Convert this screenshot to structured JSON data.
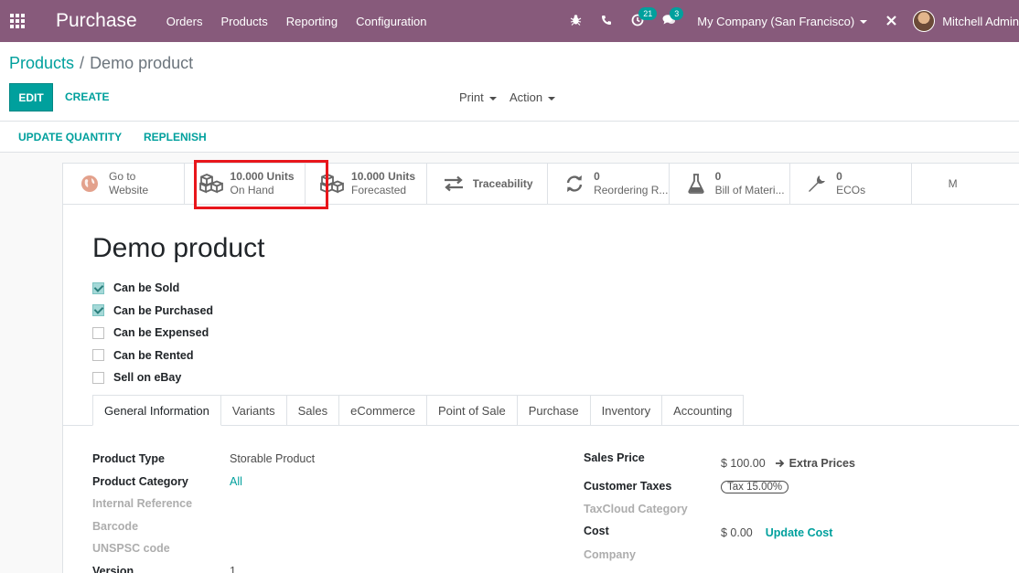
{
  "navbar": {
    "app_title": "Purchase",
    "menu": [
      "Orders",
      "Products",
      "Reporting",
      "Configuration"
    ],
    "activity_count": "21",
    "messages_count": "3",
    "company": "My Company (San Francisco)",
    "user": "Mitchell Admin"
  },
  "breadcrumb": {
    "parent": "Products",
    "separator": "/",
    "current": "Demo product"
  },
  "control": {
    "edit": "EDIT",
    "create": "CREATE",
    "print": "Print",
    "action": "Action"
  },
  "statusbar": {
    "update_quantity": "UPDATE QUANTITY",
    "replenish": "REPLENISH"
  },
  "smart_buttons": [
    {
      "value": "Go to",
      "label": "Website",
      "icon": "globe-icon"
    },
    {
      "value": "10.000 Units",
      "label": "On Hand",
      "icon": "cubes-icon"
    },
    {
      "value": "10.000 Units",
      "label": "Forecasted",
      "icon": "cubes-icon"
    },
    {
      "value": "",
      "label": "Traceability",
      "icon": "exchange-icon"
    },
    {
      "value": "0",
      "label": "Reordering R...",
      "icon": "refresh-icon"
    },
    {
      "value": "0",
      "label": "Bill of Materi...",
      "icon": "flask-icon"
    },
    {
      "value": "0",
      "label": "ECOs",
      "icon": "wrench-icon"
    },
    {
      "value": "",
      "label": "M",
      "icon": "more-icon"
    }
  ],
  "form": {
    "title": "Demo product",
    "checkboxes": [
      {
        "label": "Can be Sold",
        "checked": true
      },
      {
        "label": "Can be Purchased",
        "checked": true
      },
      {
        "label": "Can be Expensed",
        "checked": false
      },
      {
        "label": "Can be Rented",
        "checked": false
      },
      {
        "label": "Sell on eBay",
        "checked": false
      }
    ],
    "tabs": [
      "General Information",
      "Variants",
      "Sales",
      "eCommerce",
      "Point of Sale",
      "Purchase",
      "Inventory",
      "Accounting"
    ],
    "active_tab": "General Information",
    "left_fields": {
      "product_type_label": "Product Type",
      "product_type_value": "Storable Product",
      "product_category_label": "Product Category",
      "product_category_value": "All",
      "internal_reference_label": "Internal Reference",
      "barcode_label": "Barcode",
      "unspsc_label": "UNSPSC code",
      "version_label": "Version",
      "version_value": "1"
    },
    "right_fields": {
      "sales_price_label": "Sales Price",
      "sales_price_value": "$ 100.00",
      "extra_prices": "Extra Prices",
      "customer_taxes_label": "Customer Taxes",
      "customer_taxes_value": "Tax 15.00%",
      "taxcloud_label": "TaxCloud Category",
      "cost_label": "Cost",
      "cost_value": "$ 0.00",
      "update_cost": "Update Cost",
      "company_label": "Company"
    }
  },
  "colors": {
    "navbar": "#875a7b",
    "accent": "#00a09d",
    "highlight": "#e8161b"
  }
}
